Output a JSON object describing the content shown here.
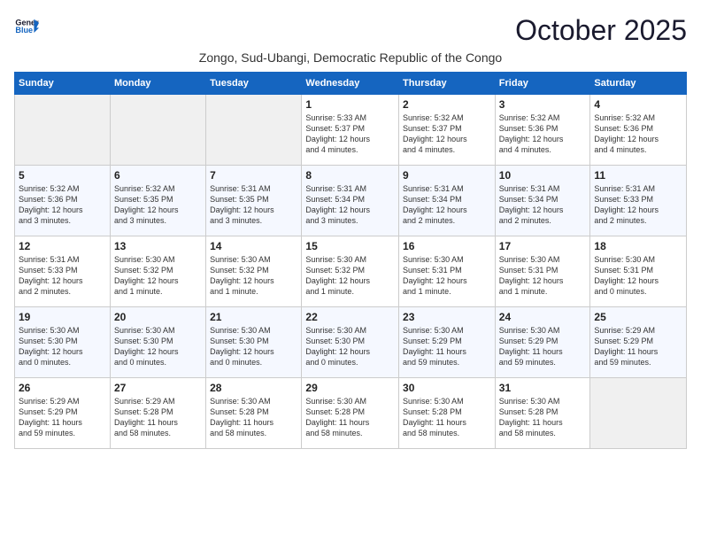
{
  "logo": {
    "line1": "General",
    "line2": "Blue"
  },
  "title": "October 2025",
  "subtitle": "Zongo, Sud-Ubangi, Democratic Republic of the Congo",
  "headers": [
    "Sunday",
    "Monday",
    "Tuesday",
    "Wednesday",
    "Thursday",
    "Friday",
    "Saturday"
  ],
  "weeks": [
    [
      {
        "day": "",
        "info": ""
      },
      {
        "day": "",
        "info": ""
      },
      {
        "day": "",
        "info": ""
      },
      {
        "day": "1",
        "info": "Sunrise: 5:33 AM\nSunset: 5:37 PM\nDaylight: 12 hours\nand 4 minutes."
      },
      {
        "day": "2",
        "info": "Sunrise: 5:32 AM\nSunset: 5:37 PM\nDaylight: 12 hours\nand 4 minutes."
      },
      {
        "day": "3",
        "info": "Sunrise: 5:32 AM\nSunset: 5:36 PM\nDaylight: 12 hours\nand 4 minutes."
      },
      {
        "day": "4",
        "info": "Sunrise: 5:32 AM\nSunset: 5:36 PM\nDaylight: 12 hours\nand 4 minutes."
      }
    ],
    [
      {
        "day": "5",
        "info": "Sunrise: 5:32 AM\nSunset: 5:36 PM\nDaylight: 12 hours\nand 3 minutes."
      },
      {
        "day": "6",
        "info": "Sunrise: 5:32 AM\nSunset: 5:35 PM\nDaylight: 12 hours\nand 3 minutes."
      },
      {
        "day": "7",
        "info": "Sunrise: 5:31 AM\nSunset: 5:35 PM\nDaylight: 12 hours\nand 3 minutes."
      },
      {
        "day": "8",
        "info": "Sunrise: 5:31 AM\nSunset: 5:34 PM\nDaylight: 12 hours\nand 3 minutes."
      },
      {
        "day": "9",
        "info": "Sunrise: 5:31 AM\nSunset: 5:34 PM\nDaylight: 12 hours\nand 2 minutes."
      },
      {
        "day": "10",
        "info": "Sunrise: 5:31 AM\nSunset: 5:34 PM\nDaylight: 12 hours\nand 2 minutes."
      },
      {
        "day": "11",
        "info": "Sunrise: 5:31 AM\nSunset: 5:33 PM\nDaylight: 12 hours\nand 2 minutes."
      }
    ],
    [
      {
        "day": "12",
        "info": "Sunrise: 5:31 AM\nSunset: 5:33 PM\nDaylight: 12 hours\nand 2 minutes."
      },
      {
        "day": "13",
        "info": "Sunrise: 5:30 AM\nSunset: 5:32 PM\nDaylight: 12 hours\nand 1 minute."
      },
      {
        "day": "14",
        "info": "Sunrise: 5:30 AM\nSunset: 5:32 PM\nDaylight: 12 hours\nand 1 minute."
      },
      {
        "day": "15",
        "info": "Sunrise: 5:30 AM\nSunset: 5:32 PM\nDaylight: 12 hours\nand 1 minute."
      },
      {
        "day": "16",
        "info": "Sunrise: 5:30 AM\nSunset: 5:31 PM\nDaylight: 12 hours\nand 1 minute."
      },
      {
        "day": "17",
        "info": "Sunrise: 5:30 AM\nSunset: 5:31 PM\nDaylight: 12 hours\nand 1 minute."
      },
      {
        "day": "18",
        "info": "Sunrise: 5:30 AM\nSunset: 5:31 PM\nDaylight: 12 hours\nand 0 minutes."
      }
    ],
    [
      {
        "day": "19",
        "info": "Sunrise: 5:30 AM\nSunset: 5:30 PM\nDaylight: 12 hours\nand 0 minutes."
      },
      {
        "day": "20",
        "info": "Sunrise: 5:30 AM\nSunset: 5:30 PM\nDaylight: 12 hours\nand 0 minutes."
      },
      {
        "day": "21",
        "info": "Sunrise: 5:30 AM\nSunset: 5:30 PM\nDaylight: 12 hours\nand 0 minutes."
      },
      {
        "day": "22",
        "info": "Sunrise: 5:30 AM\nSunset: 5:30 PM\nDaylight: 12 hours\nand 0 minutes."
      },
      {
        "day": "23",
        "info": "Sunrise: 5:30 AM\nSunset: 5:29 PM\nDaylight: 11 hours\nand 59 minutes."
      },
      {
        "day": "24",
        "info": "Sunrise: 5:30 AM\nSunset: 5:29 PM\nDaylight: 11 hours\nand 59 minutes."
      },
      {
        "day": "25",
        "info": "Sunrise: 5:29 AM\nSunset: 5:29 PM\nDaylight: 11 hours\nand 59 minutes."
      }
    ],
    [
      {
        "day": "26",
        "info": "Sunrise: 5:29 AM\nSunset: 5:29 PM\nDaylight: 11 hours\nand 59 minutes."
      },
      {
        "day": "27",
        "info": "Sunrise: 5:29 AM\nSunset: 5:28 PM\nDaylight: 11 hours\nand 58 minutes."
      },
      {
        "day": "28",
        "info": "Sunrise: 5:30 AM\nSunset: 5:28 PM\nDaylight: 11 hours\nand 58 minutes."
      },
      {
        "day": "29",
        "info": "Sunrise: 5:30 AM\nSunset: 5:28 PM\nDaylight: 11 hours\nand 58 minutes."
      },
      {
        "day": "30",
        "info": "Sunrise: 5:30 AM\nSunset: 5:28 PM\nDaylight: 11 hours\nand 58 minutes."
      },
      {
        "day": "31",
        "info": "Sunrise: 5:30 AM\nSunset: 5:28 PM\nDaylight: 11 hours\nand 58 minutes."
      },
      {
        "day": "",
        "info": ""
      }
    ]
  ]
}
